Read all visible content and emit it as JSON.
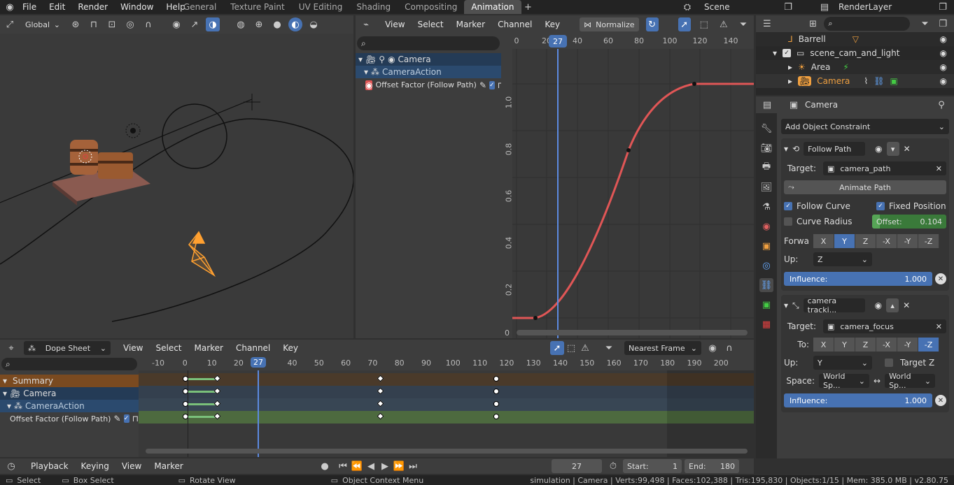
{
  "topbar": {
    "menus": [
      "File",
      "Edit",
      "Render",
      "Window",
      "Help"
    ],
    "tabs": [
      "General",
      "Texture Paint",
      "UV Editing",
      "Shading",
      "Compositing",
      "Animation"
    ],
    "active_tab": "Animation",
    "scene": "Scene",
    "render_layer": "RenderLayer"
  },
  "viewport": {
    "orientation": "Global"
  },
  "graph_editor": {
    "menus": [
      "View",
      "Select",
      "Marker",
      "Channel",
      "Key"
    ],
    "normalize_label": "Normalize",
    "x_ticks": [
      "0",
      "20",
      "40",
      "60",
      "80",
      "100",
      "120",
      "140"
    ],
    "y_ticks": [
      "1.0",
      "0.8",
      "0.6",
      "0.4",
      "0.2",
      "0"
    ],
    "current_frame": "27",
    "channels": {
      "camera": "Camera",
      "action": "CameraAction",
      "fcurve": "Offset Factor (Follow Path)"
    },
    "accent": "#e05656"
  },
  "outliner": {
    "items": [
      {
        "label": "Barrell"
      },
      {
        "label": "scene_cam_and_light"
      },
      {
        "label": "Area"
      },
      {
        "label": "Camera"
      }
    ]
  },
  "properties": {
    "object_name": "Camera",
    "add_constraint": "Add Object Constraint",
    "follow_path": {
      "name": "Follow Path",
      "target_label": "Target:",
      "target": "camera_path",
      "animate_path": "Animate Path",
      "follow_curve": "Follow Curve",
      "fixed_position": "Fixed Position",
      "curve_radius": "Curve Radius",
      "offset_label": "Offset:",
      "offset_value": "0.104",
      "offset_fraction": 0.104,
      "forward_label": "Forwa",
      "axes": [
        "X",
        "Y",
        "Z",
        "-X",
        "-Y",
        "-Z"
      ],
      "forward_active": "Y",
      "up_label": "Up:",
      "up_value": "Z",
      "influence_label": "Influence:",
      "influence_value": "1.000"
    },
    "track": {
      "name": "camera tracki...",
      "target_label": "Target:",
      "target": "camera_focus",
      "to_label": "To:",
      "to_active": "-Z",
      "up_label": "Up:",
      "up_value": "Y",
      "target_z": "Target Z",
      "space_label": "Space:",
      "space_a": "World Sp...",
      "space_b": "World Sp...",
      "influence_label": "Influence:",
      "influence_value": "1.000"
    }
  },
  "dopesheet": {
    "mode": "Dope Sheet",
    "menus": [
      "View",
      "Select",
      "Marker",
      "Channel",
      "Key"
    ],
    "snap": "Nearest Frame",
    "ticks": [
      "-10",
      "0",
      "10",
      "20",
      "27",
      "40",
      "50",
      "60",
      "70",
      "80",
      "90",
      "100",
      "110",
      "120",
      "130",
      "140",
      "150",
      "160",
      "170",
      "180",
      "190",
      "200"
    ],
    "channels": [
      "Summary",
      "Camera",
      "CameraAction",
      "Offset Factor (Follow Path)"
    ]
  },
  "timeline": {
    "menus": [
      "Playback",
      "Keying",
      "View",
      "Marker"
    ],
    "frame": "27",
    "start_label": "Start:",
    "start": "1",
    "end_label": "End:",
    "end": "180"
  },
  "statusbar": {
    "select": "Select",
    "box_select": "Box Select",
    "rotate_view": "Rotate View",
    "context_menu": "Object Context Menu",
    "stats": "simulation | Camera | Verts:99,498 | Faces:102,388 | Tris:195,830 | Objects:1/15 | Mem: 385.0 MB | v2.80.75"
  }
}
